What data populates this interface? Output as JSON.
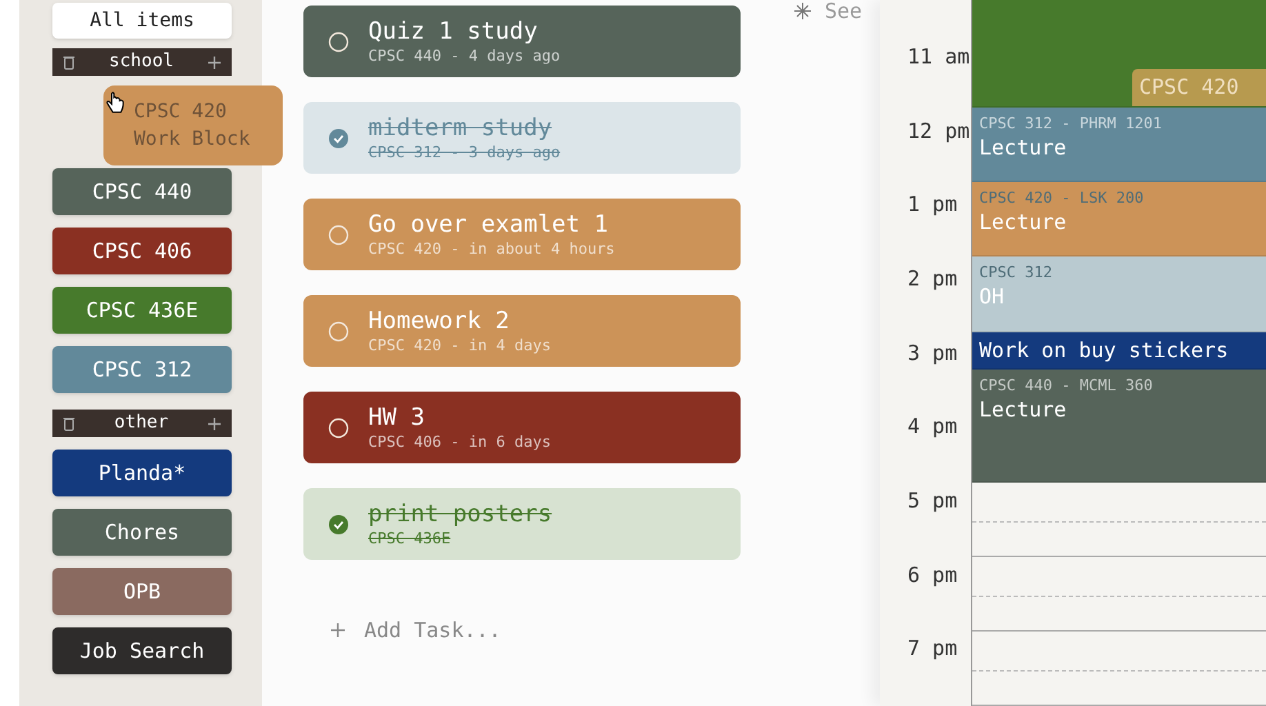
{
  "sidebar": {
    "all_items": "All items",
    "groups": [
      {
        "name": "school",
        "items": [
          {
            "label": "CPSC 440",
            "color": "#56645a"
          },
          {
            "label": "CPSC 406",
            "color": "#8a3022"
          },
          {
            "label": "CPSC 436E",
            "color": "#477a2c"
          },
          {
            "label": "CPSC 312",
            "color": "#62899a"
          }
        ]
      },
      {
        "name": "other",
        "items": [
          {
            "label": "Planda*",
            "color": "#143a7e"
          },
          {
            "label": "Chores",
            "color": "#56645a"
          },
          {
            "label": "OPB",
            "color": "#8a6a60"
          },
          {
            "label": "Job Search",
            "color": "#2e2c2b"
          }
        ]
      }
    ],
    "dragging": {
      "title": "CPSC 420",
      "subtitle": "Work Block",
      "color": "#cc9358"
    }
  },
  "tasks": [
    {
      "title": "Quiz 1 study",
      "subtitle": "CPSC 440 - 4 days ago",
      "color": "#56645a",
      "done": false
    },
    {
      "title": "midterm study",
      "subtitle": "CPSC 312 - 3 days ago",
      "color": "#62899a",
      "done": true
    },
    {
      "title": "Go over examlet 1",
      "subtitle": "CPSC 420 - in about 4 hours",
      "color": "#cc9358",
      "done": false
    },
    {
      "title": "Homework 2",
      "subtitle": "CPSC 420 - in 4 days",
      "color": "#cc9358",
      "done": false
    },
    {
      "title": "HW 3",
      "subtitle": "CPSC 406 - in 6 days",
      "color": "#8a3022",
      "done": false
    },
    {
      "title": "print posters",
      "subtitle": "CPSC 436E",
      "color": "#477a2c",
      "done": true
    }
  ],
  "add_task": "Add Task...",
  "see_link": "See",
  "calendar": {
    "times": [
      "11 am",
      "12 pm",
      "1 pm",
      "2 pm",
      "3 pm",
      "4 pm",
      "5 pm",
      "6 pm",
      "7 pm"
    ],
    "events": [
      {
        "kind": "top",
        "color": "#477a2c",
        "overlay": "CPSC 420"
      },
      {
        "kind": "hour",
        "color": "#62899a",
        "subtitle": "CPSC 312 - PHRM 1201",
        "title": "Lecture"
      },
      {
        "kind": "hour",
        "color": "#cc9358",
        "subtitle": "CPSC 420 - LSK 200",
        "title": "Lecture"
      },
      {
        "kind": "hour",
        "color": "#b9cad0",
        "subtitle": "CPSC 312",
        "title": "OH"
      },
      {
        "kind": "half",
        "color": "#143a7e",
        "title": "Work on buy stickers"
      },
      {
        "kind": "hour_half",
        "color": "#56645a",
        "subtitle": "CPSC 440 - MCML 360",
        "title": "Lecture"
      }
    ]
  }
}
